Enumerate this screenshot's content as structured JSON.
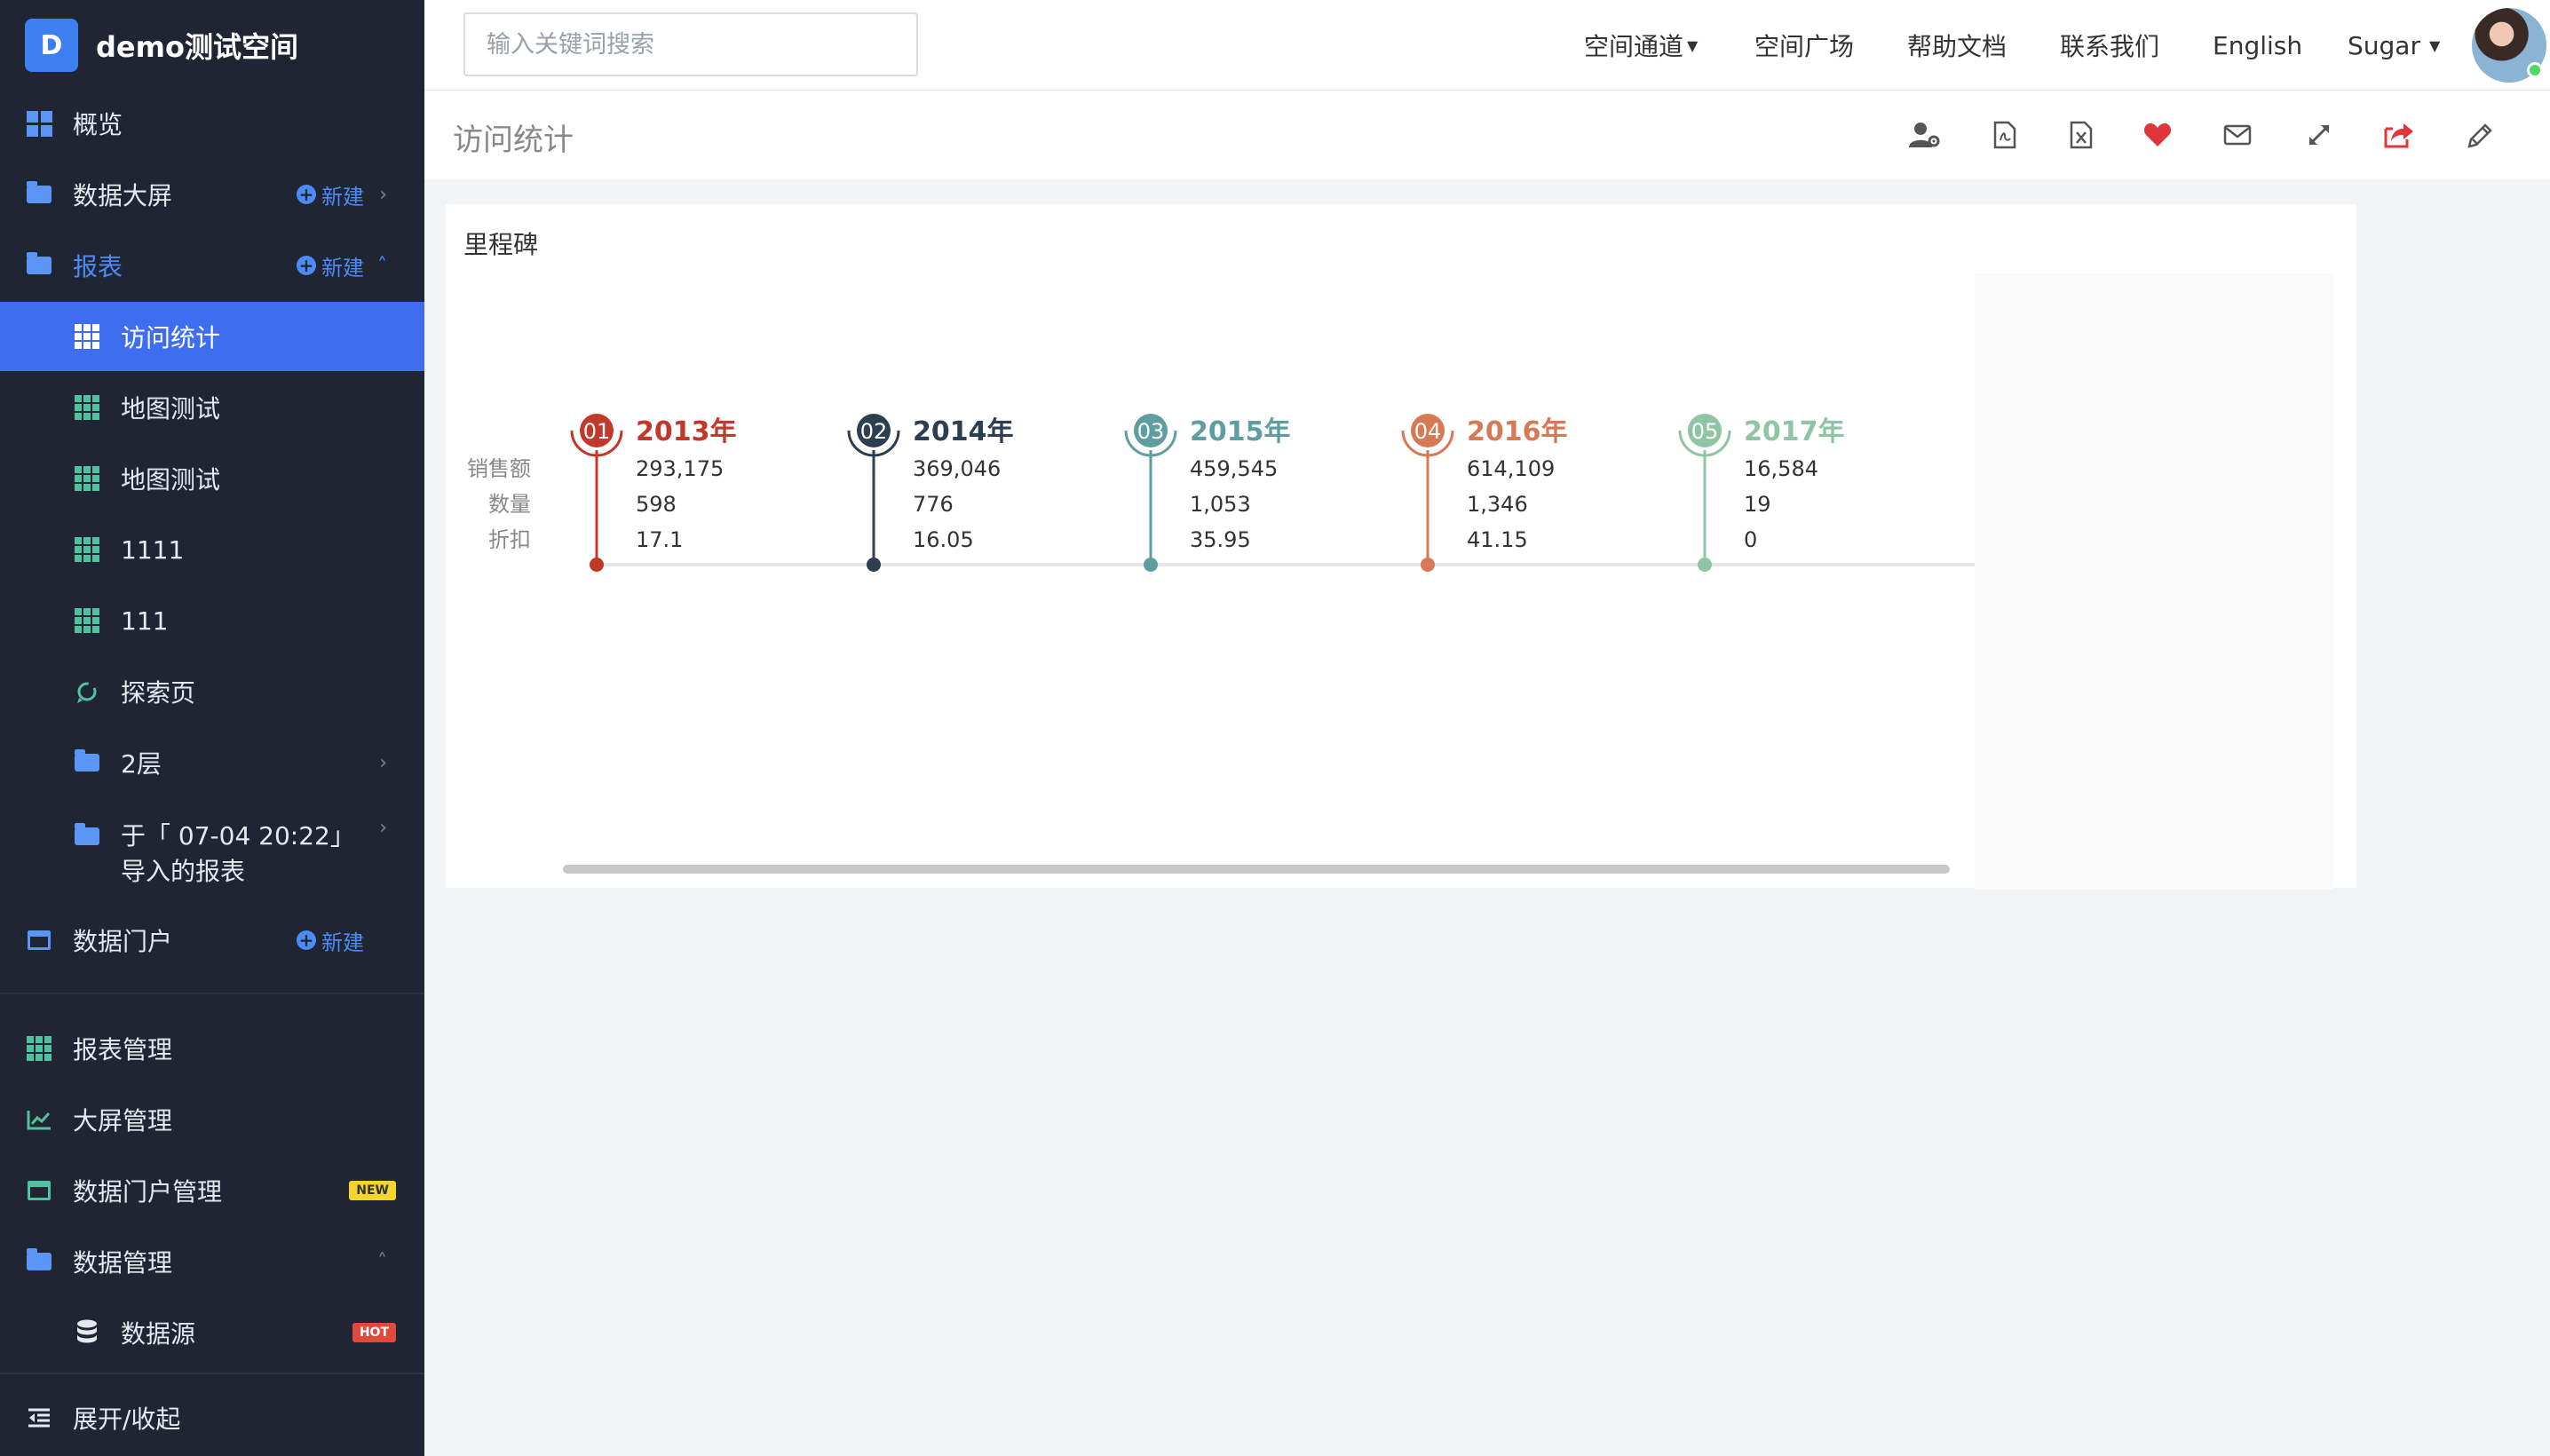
{
  "app": {
    "logo_letter": "D",
    "workspace": "demo测试空间"
  },
  "sidebar": {
    "items": [
      {
        "label": "概览",
        "icon": "dashboard-grid-icon"
      },
      {
        "label": "数据大屏",
        "icon": "folder-icon",
        "action": "新建"
      },
      {
        "label": "报表",
        "icon": "folder-icon",
        "action": "新建"
      },
      {
        "label": "访问统计",
        "icon": "table-grid-icon"
      },
      {
        "label": "地图测试",
        "icon": "table-grid-icon"
      },
      {
        "label": "地图测试",
        "icon": "table-grid-icon"
      },
      {
        "label": "1111",
        "icon": "table-grid-icon"
      },
      {
        "label": "111",
        "icon": "table-grid-icon"
      },
      {
        "label": "探索页",
        "icon": "explore-icon"
      },
      {
        "label": "2层",
        "icon": "folder-icon"
      },
      {
        "label_line1": "于「 07-04 20:22」",
        "label_line2": "导入的报表",
        "icon": "folder-icon"
      },
      {
        "label": "数据门户",
        "icon": "window-icon",
        "action": "新建"
      },
      {
        "label": "报表管理",
        "icon": "table-grid-icon"
      },
      {
        "label": "大屏管理",
        "icon": "line-chart-icon"
      },
      {
        "label": "数据门户管理",
        "icon": "window-icon",
        "badge": "NEW"
      },
      {
        "label": "数据管理",
        "icon": "folder-icon"
      },
      {
        "label": "数据源",
        "icon": "database-icon",
        "badge": "HOT"
      },
      {
        "label": "展开/收起",
        "icon": "collapse-icon"
      }
    ]
  },
  "topbar": {
    "search_placeholder": "输入关键词搜索",
    "nav": [
      "空间通道",
      "空间广场",
      "帮助文档",
      "联系我们",
      "English",
      "Sugar"
    ]
  },
  "page": {
    "title": "访问统计"
  },
  "toolbar": [
    "user-settings-icon",
    "export-pdf-icon",
    "export-excel-icon",
    "favorite-heart-icon",
    "mail-icon",
    "fullscreen-icon",
    "share-icon",
    "edit-pencil-icon"
  ],
  "card": {
    "title": "里程碑"
  },
  "chart_data": {
    "type": "table",
    "row_labels": [
      "销售额",
      "数量",
      "折扣"
    ],
    "milestones": [
      {
        "index": "01",
        "year": "2013年",
        "values": [
          "293,175",
          "598",
          "17.1"
        ],
        "color": "#c0392b"
      },
      {
        "index": "02",
        "year": "2014年",
        "values": [
          "369,046",
          "776",
          "16.05"
        ],
        "color": "#2c3e50"
      },
      {
        "index": "03",
        "year": "2015年",
        "values": [
          "459,545",
          "1,053",
          "35.95"
        ],
        "color": "#5f9ea0"
      },
      {
        "index": "04",
        "year": "2016年",
        "values": [
          "614,109",
          "1,346",
          "41.15"
        ],
        "color": "#d67a55"
      },
      {
        "index": "05",
        "year": "2017年",
        "values": [
          "16,584",
          "19",
          "0"
        ],
        "color": "#8fc4a4"
      }
    ]
  }
}
